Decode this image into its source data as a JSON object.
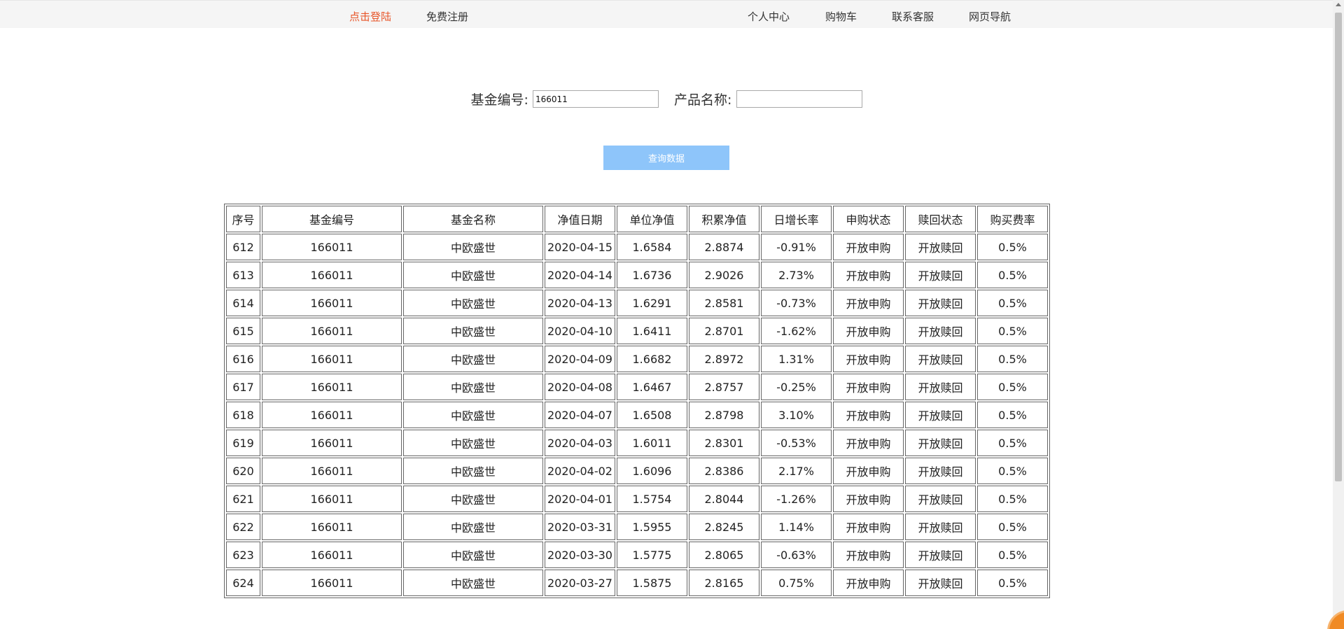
{
  "topbar": {
    "login": "点击登陆",
    "register": "免费注册",
    "user_center": "个人中心",
    "cart": "购物车",
    "service": "联系客服",
    "nav": "网页导航"
  },
  "search": {
    "fund_code_label": "基金编号:",
    "fund_code_value": "166011",
    "product_name_label": "产品名称:",
    "product_name_value": "",
    "query_button": "查询数据"
  },
  "table": {
    "headers": [
      "序号",
      "基金编号",
      "基金名称",
      "净值日期",
      "单位净值",
      "积累净值",
      "日增长率",
      "申购状态",
      "赎回状态",
      "购买费率"
    ],
    "rows": [
      [
        "612",
        "166011",
        "中欧盛世",
        "2020-04-15",
        "1.6584",
        "2.8874",
        "-0.91%",
        "开放申购",
        "开放赎回",
        "0.5%"
      ],
      [
        "613",
        "166011",
        "中欧盛世",
        "2020-04-14",
        "1.6736",
        "2.9026",
        "2.73%",
        "开放申购",
        "开放赎回",
        "0.5%"
      ],
      [
        "614",
        "166011",
        "中欧盛世",
        "2020-04-13",
        "1.6291",
        "2.8581",
        "-0.73%",
        "开放申购",
        "开放赎回",
        "0.5%"
      ],
      [
        "615",
        "166011",
        "中欧盛世",
        "2020-04-10",
        "1.6411",
        "2.8701",
        "-1.62%",
        "开放申购",
        "开放赎回",
        "0.5%"
      ],
      [
        "616",
        "166011",
        "中欧盛世",
        "2020-04-09",
        "1.6682",
        "2.8972",
        "1.31%",
        "开放申购",
        "开放赎回",
        "0.5%"
      ],
      [
        "617",
        "166011",
        "中欧盛世",
        "2020-04-08",
        "1.6467",
        "2.8757",
        "-0.25%",
        "开放申购",
        "开放赎回",
        "0.5%"
      ],
      [
        "618",
        "166011",
        "中欧盛世",
        "2020-04-07",
        "1.6508",
        "2.8798",
        "3.10%",
        "开放申购",
        "开放赎回",
        "0.5%"
      ],
      [
        "619",
        "166011",
        "中欧盛世",
        "2020-04-03",
        "1.6011",
        "2.8301",
        "-0.53%",
        "开放申购",
        "开放赎回",
        "0.5%"
      ],
      [
        "620",
        "166011",
        "中欧盛世",
        "2020-04-02",
        "1.6096",
        "2.8386",
        "2.17%",
        "开放申购",
        "开放赎回",
        "0.5%"
      ],
      [
        "621",
        "166011",
        "中欧盛世",
        "2020-04-01",
        "1.5754",
        "2.8044",
        "-1.26%",
        "开放申购",
        "开放赎回",
        "0.5%"
      ],
      [
        "622",
        "166011",
        "中欧盛世",
        "2020-03-31",
        "1.5955",
        "2.8245",
        "1.14%",
        "开放申购",
        "开放赎回",
        "0.5%"
      ],
      [
        "623",
        "166011",
        "中欧盛世",
        "2020-03-30",
        "1.5775",
        "2.8065",
        "-0.63%",
        "开放申购",
        "开放赎回",
        "0.5%"
      ],
      [
        "624",
        "166011",
        "中欧盛世",
        "2020-03-27",
        "1.5875",
        "2.8165",
        "0.75%",
        "开放申购",
        "开放赎回",
        "0.5%"
      ]
    ]
  }
}
